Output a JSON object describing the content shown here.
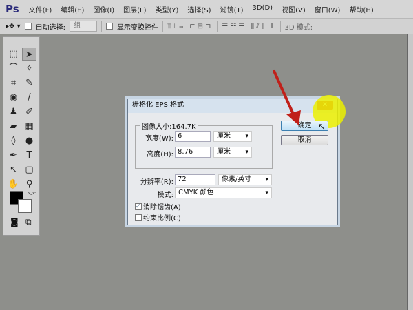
{
  "app": {
    "logo": "Ps"
  },
  "menu": [
    "文件(F)",
    "编辑(E)",
    "图像(I)",
    "图层(L)",
    "类型(Y)",
    "选择(S)",
    "滤镜(T)",
    "3D(D)",
    "视图(V)",
    "窗口(W)",
    "帮助(H)"
  ],
  "options": {
    "auto_select": "自动选择:",
    "group": "组",
    "show_transform": "显示变换控件",
    "align_icons": "⫪⫫⫬ ⊏⊟⊐",
    "distribute_icons": "☰☷☰ ⫼⫽⫼ ⫴",
    "mode_3d": "3D 模式:"
  },
  "tools": [
    "⬚",
    "➤",
    "⌒",
    "✧",
    "⌗",
    "✎",
    "◉",
    "/",
    "♟",
    "✐",
    "▰",
    "▦",
    "◊",
    "●",
    "✒",
    "T",
    "↖",
    "▢",
    "✋",
    "⚲"
  ],
  "dialog": {
    "title": "栅格化 EPS 格式",
    "close": "✕",
    "size_label": "图像大小:164.7K",
    "width_label": "宽度(W):",
    "width_value": "6",
    "width_unit": "厘米",
    "height_label": "高度(H):",
    "height_value": "8.76",
    "height_unit": "厘米",
    "res_label": "分辨率(R):",
    "res_value": "72",
    "res_unit": "像素/英寸",
    "mode_label": "模式:",
    "mode_value": "CMYK 颜色",
    "antialias_label": "消除锯齿(A)",
    "antialias_checked": true,
    "constrain_label": "约束比例(C)",
    "constrain_checked": false,
    "ok": "确定",
    "cancel": "取消"
  },
  "colors": {
    "annotation_arrow": "#c0201a",
    "highlight": "#ebf000"
  }
}
